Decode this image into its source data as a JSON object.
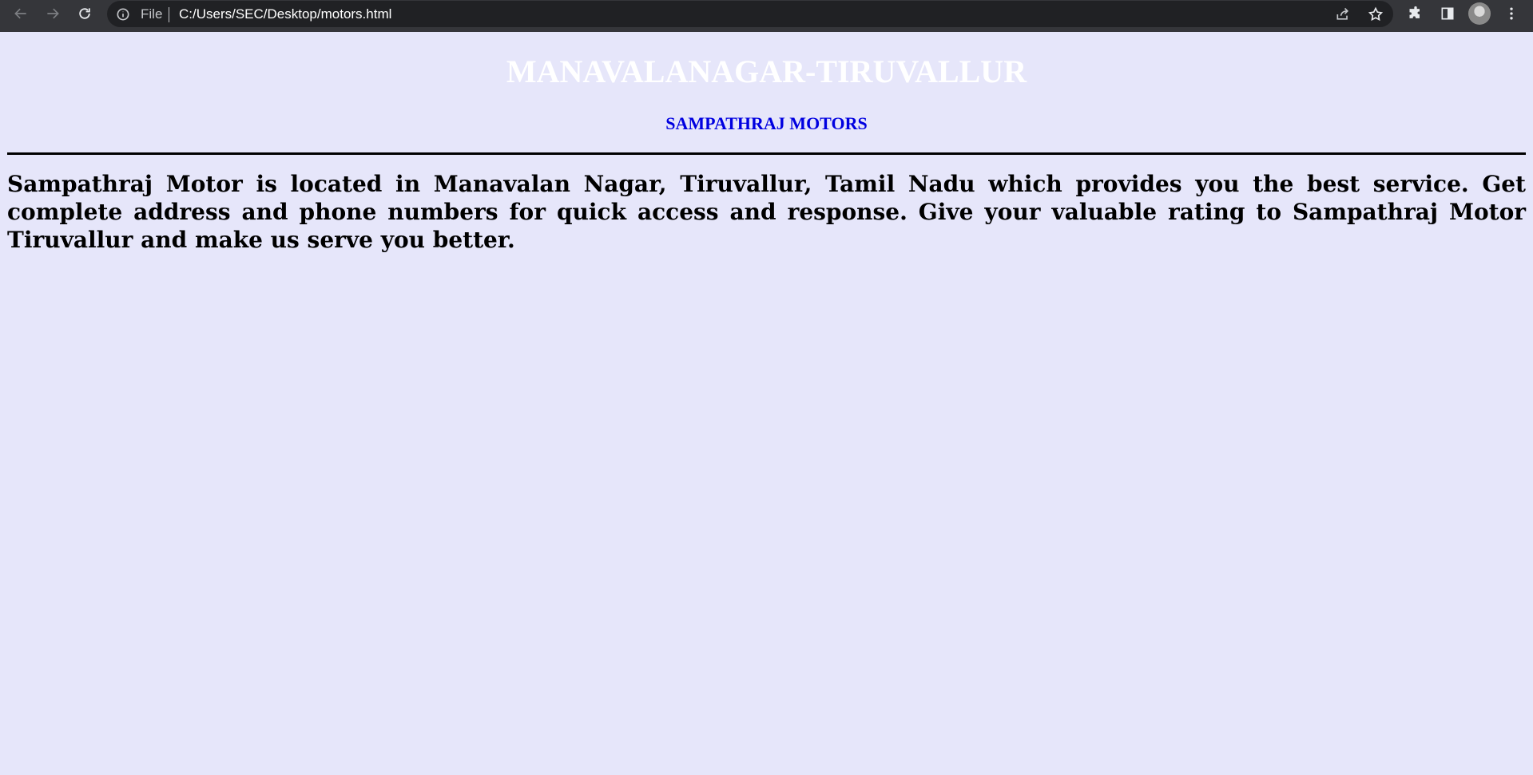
{
  "browser": {
    "scheme_label": "File",
    "url": "C:/Users/SEC/Desktop/motors.html",
    "icons": [
      "back-arrow-icon",
      "forward-arrow-icon",
      "reload-icon",
      "info-icon",
      "share-icon",
      "star-icon",
      "puzzle-icon",
      "side-panel-icon",
      "avatar",
      "menu-dots-icon"
    ]
  },
  "page": {
    "title": "MANAVALANAGAR-TIRUVALLUR",
    "subtitle": "SAMPATHRAJ MOTORS",
    "paragraph": "Sampathraj Motor is located in Manavalan Nagar, Tiruvallur, Tamil Nadu which provides you the best service. Get complete address and phone numbers for quick access and response. Give your valuable rating to Sampathraj Motor Tiruvallur and make us serve you better.",
    "background_color": "#e6e6fa",
    "title_color": "#ffffff",
    "subtitle_color": "#0000e0"
  }
}
